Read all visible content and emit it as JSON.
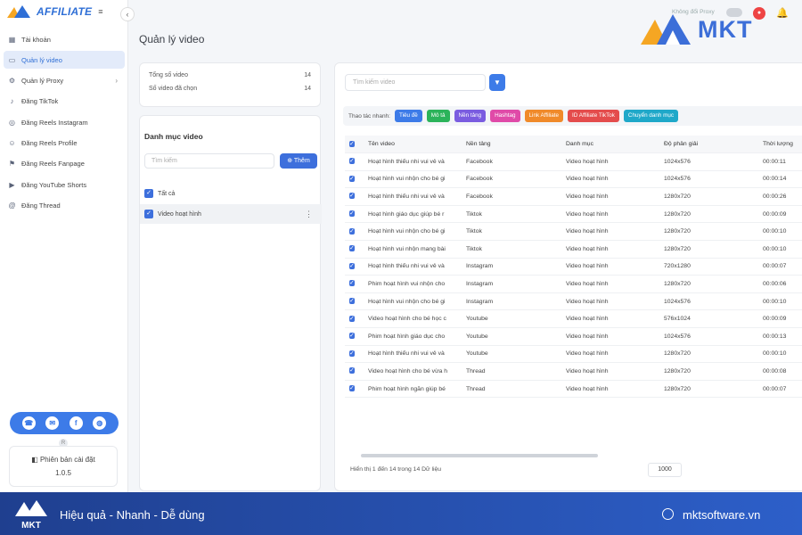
{
  "app": {
    "logo_text": "AFFILIATE",
    "menu_glyph": "≡",
    "collapse_glyph": "‹"
  },
  "header": {
    "proxy_label": "Không đổi Proxy",
    "brand_text": "MKT"
  },
  "sidebar": {
    "items": [
      {
        "label": "Tài khoản",
        "icon": "grid-icon"
      },
      {
        "label": "Quản lý video",
        "icon": "video-icon",
        "active": true
      },
      {
        "label": "Quản lý Proxy",
        "icon": "gear-icon",
        "has_arrow": true
      },
      {
        "label": "Đăng TikTok",
        "icon": "tiktok-icon"
      },
      {
        "label": "Đăng Reels Instagram",
        "icon": "instagram-icon"
      },
      {
        "label": "Đăng Reels Profile",
        "icon": "user-icon"
      },
      {
        "label": "Đăng Reels Fanpage",
        "icon": "flag-icon"
      },
      {
        "label": "Đăng YouTube Shorts",
        "icon": "youtube-icon"
      },
      {
        "label": "Đăng Thread",
        "icon": "thread-icon"
      }
    ],
    "version_label": "Phiên bản cài đặt",
    "version_value": "1.0.5"
  },
  "page": {
    "title": "Quản lý video"
  },
  "stats": {
    "total_label": "Tổng số video",
    "total_value": "14",
    "selected_label": "Số video đã chọn",
    "selected_value": "14"
  },
  "categories": {
    "title": "Danh mục video",
    "search_placeholder": "Tìm kiếm",
    "add_label": "Thêm",
    "items": [
      "Tất cả",
      "Video hoạt hình"
    ]
  },
  "videos": {
    "search_placeholder": "Tìm kiếm video",
    "quick_label": "Thao tác nhanh:",
    "chips": [
      {
        "label": "Tiêu đề",
        "color": "#3d7be8"
      },
      {
        "label": "Mô tả",
        "color": "#2bb35a"
      },
      {
        "label": "Nền tảng",
        "color": "#7a5ce0"
      },
      {
        "label": "Hashtag",
        "color": "#e04aa8"
      },
      {
        "label": "Link Affiliate",
        "color": "#f08a2a"
      },
      {
        "label": "ID Affiliate TikTok",
        "color": "#e44c4c"
      },
      {
        "label": "Chuyển danh mục",
        "color": "#1fa8c9"
      }
    ],
    "columns": [
      "Tên video",
      "Nền tảng",
      "Danh mục",
      "Độ phân giải",
      "Thời lượng"
    ],
    "rows": [
      [
        "Hoạt hình thiếu nhi vui vẻ và",
        "Facebook",
        "Video hoạt hình",
        "1024x576",
        "00:00:11"
      ],
      [
        "Hoạt hình vui nhộn cho bé gi",
        "Facebook",
        "Video hoạt hình",
        "1024x576",
        "00:00:14"
      ],
      [
        "Hoạt hình thiếu nhi vui vẻ và",
        "Facebook",
        "Video hoạt hình",
        "1280x720",
        "00:00:26"
      ],
      [
        "Hoạt hình giáo dục giúp bé r",
        "Tiktok",
        "Video hoạt hình",
        "1280x720",
        "00:00:09"
      ],
      [
        "Hoạt hình vui nhộn cho bé gi",
        "Tiktok",
        "Video hoạt hình",
        "1280x720",
        "00:00:10"
      ],
      [
        "Hoạt hình vui nhộn mang bài",
        "Tiktok",
        "Video hoạt hình",
        "1280x720",
        "00:00:10"
      ],
      [
        "Hoạt hình thiếu nhi vui vẻ và",
        "Instagram",
        "Video hoạt hình",
        "720x1280",
        "00:00:07"
      ],
      [
        "Phim hoạt hình vui nhộn cho",
        "Instagram",
        "Video hoạt hình",
        "1280x720",
        "00:00:06"
      ],
      [
        "Hoạt hình vui nhộn cho bé gi",
        "Instagram",
        "Video hoạt hình",
        "1024x576",
        "00:00:10"
      ],
      [
        "Video hoạt hình cho bé học c",
        "Youtube",
        "Video hoạt hình",
        "576x1024",
        "00:00:09"
      ],
      [
        "Phim hoạt hình giáo dục cho",
        "Youtube",
        "Video hoạt hình",
        "1024x576",
        "00:00:13"
      ],
      [
        "Hoạt hình thiếu nhi vui vẻ và",
        "Youtube",
        "Video hoạt hình",
        "1280x720",
        "00:00:10"
      ],
      [
        "Video hoạt hình cho bé vừa h",
        "Thread",
        "Video hoạt hình",
        "1280x720",
        "00:00:08"
      ],
      [
        "Phim hoạt hình ngắn giúp bé",
        "Thread",
        "Video hoạt hình",
        "1280x720",
        "00:00:07"
      ]
    ],
    "footer_info": "Hiển thị 1 đến 14 trong 14 Dữ liệu",
    "page_size": "1000"
  },
  "banner": {
    "tagline": "Hiệu quả - Nhanh - Dễ dùng",
    "website": "mktsoftware.vn",
    "logo_text": "MKT"
  },
  "colors": {
    "primary": "#3d7be8",
    "banner": "#2d5fc9"
  }
}
